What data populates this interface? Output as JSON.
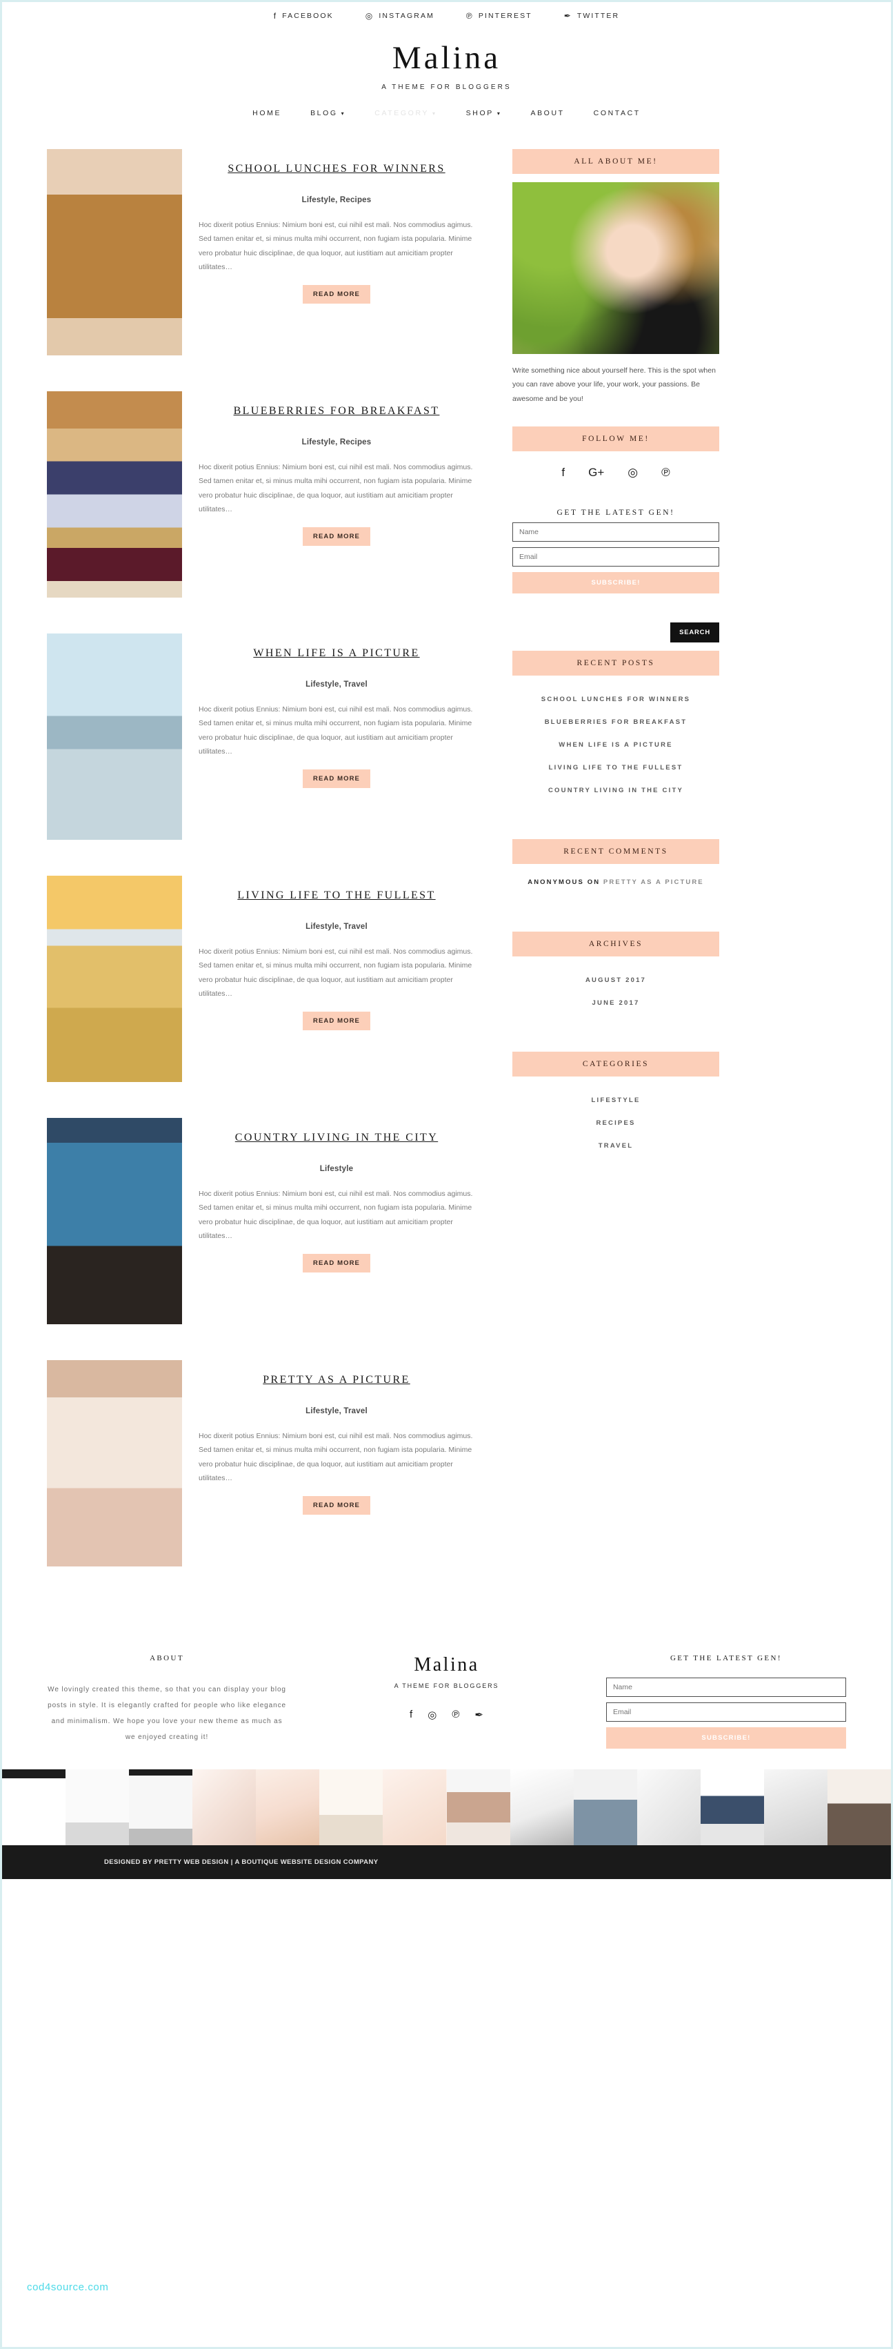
{
  "theme": {
    "accent_peach": "#FCCFB9",
    "border_teal": "#D8EEF0",
    "dark": "#1A1A1A"
  },
  "topbar": {
    "social": [
      {
        "label": "FACEBOOK",
        "icon": "facebook-icon",
        "glyph": "f"
      },
      {
        "label": "INSTAGRAM",
        "icon": "instagram-icon",
        "glyph": "◎"
      },
      {
        "label": "PINTEREST",
        "icon": "pinterest-icon",
        "glyph": "℗"
      },
      {
        "label": "TWITTER",
        "icon": "twitter-icon",
        "glyph": "✒"
      }
    ]
  },
  "header": {
    "brand": "Malina",
    "tagline": "A THEME FOR BLOGGERS",
    "nav": [
      {
        "label": "HOME",
        "has_dropdown": false,
        "faded": false
      },
      {
        "label": "BLOG",
        "has_dropdown": true,
        "faded": false
      },
      {
        "label": "CATEGORY",
        "has_dropdown": true,
        "faded": true
      },
      {
        "label": "SHOP",
        "has_dropdown": true,
        "faded": false
      },
      {
        "label": "ABOUT",
        "has_dropdown": false,
        "faded": false
      },
      {
        "label": "CONTACT",
        "has_dropdown": false,
        "faded": false
      }
    ]
  },
  "posts": [
    {
      "title": "SCHOOL LUNCHES FOR WINNERS",
      "categories": "Lifestyle, Recipes",
      "excerpt": "Hoc dixerit potius Ennius: Nimium boni est, cui nihil est mali. Nos commodius agimus. Sed tamen enitar et, si minus multa mihi occurrent, non fugiam ista popularia. Minime vero probatur huic disciplinae, de qua loquor, aut iustitiam aut amicitiam propter utilitates…",
      "read_more": "READ MORE",
      "image_alt": "figs-on-wooden-board"
    },
    {
      "title": "BLUEBERRIES FOR BREAKFAST",
      "categories": "Lifestyle, Recipes",
      "excerpt": "Hoc dixerit potius Ennius: Nimium boni est, cui nihil est mali. Nos commodius agimus. Sed tamen enitar et, si minus multa mihi occurrent, non fugiam ista popularia. Minime vero probatur huic disciplinae, de qua loquor, aut iustitiam aut amicitiam propter utilitates…",
      "read_more": "READ MORE",
      "image_alt": "blueberry-parfait-glass"
    },
    {
      "title": "WHEN LIFE IS A PICTURE",
      "categories": "Lifestyle, Travel",
      "excerpt": "Hoc dixerit potius Ennius: Nimium boni est, cui nihil est mali. Nos commodius agimus. Sed tamen enitar et, si minus multa mihi occurrent, non fugiam ista popularia. Minime vero probatur huic disciplinae, de qua loquor, aut iustitiam aut amicitiam propter utilitates…",
      "read_more": "READ MORE",
      "image_alt": "seaside-pier-long-exposure"
    },
    {
      "title": "LIVING LIFE TO THE FULLEST",
      "categories": "Lifestyle, Travel",
      "excerpt": "Hoc dixerit potius Ennius: Nimium boni est, cui nihil est mali. Nos commodius agimus. Sed tamen enitar et, si minus multa mihi occurrent, non fugiam ista popularia. Minime vero probatur huic disciplinae, de qua loquor, aut iustitiam aut amicitiam propter utilitates…",
      "read_more": "READ MORE",
      "image_alt": "mother-and-child-on-country-road"
    },
    {
      "title": "COUNTRY LIVING IN THE CITY",
      "categories": "Lifestyle",
      "excerpt": "Hoc dixerit potius Ennius: Nimium boni est, cui nihil est mali. Nos commodius agimus. Sed tamen enitar et, si minus multa mihi occurrent, non fugiam ista popularia. Minime vero probatur huic disciplinae, de qua loquor, aut iustitiam aut amicitiam propter utilitates…",
      "read_more": "READ MORE",
      "image_alt": "blue-cabinet-interior"
    },
    {
      "title": "PRETTY AS A PICTURE",
      "categories": "Lifestyle, Travel",
      "excerpt": "Hoc dixerit potius Ennius: Nimium boni est, cui nihil est mali. Nos commodius agimus. Sed tamen enitar et, si minus multa mihi occurrent, non fugiam ista popularia. Minime vero probatur huic disciplinae, de qua loquor, aut iustitiam aut amicitiam propter utilitates…",
      "read_more": "READ MORE",
      "image_alt": "love-card-candlelit-table"
    }
  ],
  "sidebar": {
    "about": {
      "title": "ALL ABOUT ME!",
      "text": "Write something nice about yourself here. This is the spot when you can rave above your life, your work, your passions. Be awesome and be you!",
      "image_alt": "portrait-of-blogger"
    },
    "follow": {
      "title": "FOLLOW ME!",
      "social": [
        {
          "icon": "facebook-icon",
          "glyph": "f"
        },
        {
          "icon": "google-plus-icon",
          "glyph": "G+"
        },
        {
          "icon": "instagram-icon",
          "glyph": "◎"
        },
        {
          "icon": "pinterest-icon",
          "glyph": "℗"
        }
      ]
    },
    "newsletter": {
      "title": "GET THE LATEST GEN!",
      "name_placeholder": "Name",
      "email_placeholder": "Email",
      "button": "SUBSCRIBE!"
    },
    "search": {
      "button": "SEARCH",
      "placeholder": ""
    },
    "recent_posts": {
      "title": "RECENT POSTS",
      "items": [
        "SCHOOL LUNCHES FOR WINNERS",
        "BLUEBERRIES FOR BREAKFAST",
        "WHEN LIFE IS A PICTURE",
        "LIVING LIFE TO THE FULLEST",
        "COUNTRY LIVING IN THE CITY"
      ]
    },
    "recent_comments": {
      "title": "RECENT COMMENTS",
      "items": [
        {
          "author": "ANONYMOUS",
          "on": "ON",
          "post": "PRETTY AS A PICTURE"
        }
      ]
    },
    "archives": {
      "title": "ARCHIVES",
      "items": [
        "AUGUST 2017",
        "JUNE 2017"
      ]
    },
    "categories": {
      "title": "CATEGORIES",
      "items": [
        "LIFESTYLE",
        "RECIPES",
        "TRAVEL"
      ]
    }
  },
  "footer": {
    "about": {
      "title": "ABOUT",
      "text": "We lovingly created this theme, so that you can display your blog posts in style. It is elegantly crafted for people who like elegance and minimalism. We hope you love your new theme as much as we enjoyed creating it!"
    },
    "brand": "Malina",
    "brand_sub": "A THEME FOR BLOGGERS",
    "social": [
      {
        "icon": "facebook-icon",
        "glyph": "f"
      },
      {
        "icon": "instagram-icon",
        "glyph": "◎"
      },
      {
        "icon": "pinterest-icon",
        "glyph": "℗"
      },
      {
        "icon": "twitter-icon",
        "glyph": "✒"
      }
    ],
    "newsletter": {
      "title": "GET THE LATEST GEN!",
      "name_placeholder": "Name",
      "email_placeholder": "Email",
      "button": "SUBSCRIBE!"
    }
  },
  "watermark": "cod4source.com",
  "bottom_bar": "DESIGNED BY PRETTY WEB DESIGN | A BOUTIQUE WEBSITE DESIGN COMPANY"
}
